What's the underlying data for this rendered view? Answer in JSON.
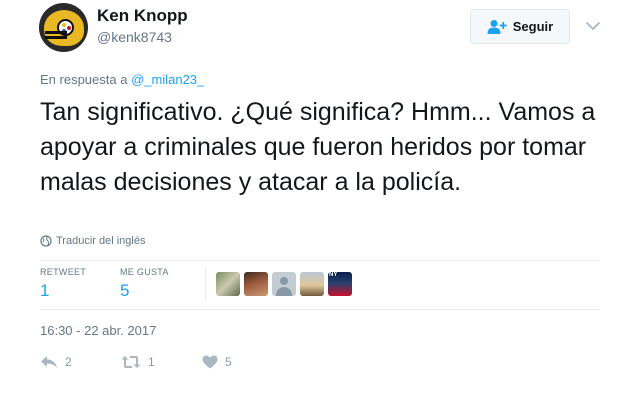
{
  "user": {
    "name": "Ken Knopp",
    "handle": "@kenk8743"
  },
  "follow_button": {
    "label": "Seguir"
  },
  "reply": {
    "prefix": "En respuesta a",
    "target": "@_milan23_"
  },
  "tweet": {
    "text": "Tan significativo. ¿Qué significa? Hmm... Vamos a apoyar a criminales que fueron heridos por tomar malas decisiones y atacar a la policía."
  },
  "translate": {
    "label": "Traducir del inglés"
  },
  "stats": {
    "retweets_label": "RETWEET",
    "retweets_count": "1",
    "likes_label": "ME GUSTA",
    "likes_count": "5"
  },
  "timestamp": "16:30 - 22 abr. 2017",
  "actions": {
    "reply_count": "2",
    "retweet_count": "1",
    "like_count": "5"
  },
  "colors": {
    "accent": "#1da1f2",
    "muted": "#657786",
    "icon_gray": "#8899a6",
    "text": "#14171a"
  }
}
